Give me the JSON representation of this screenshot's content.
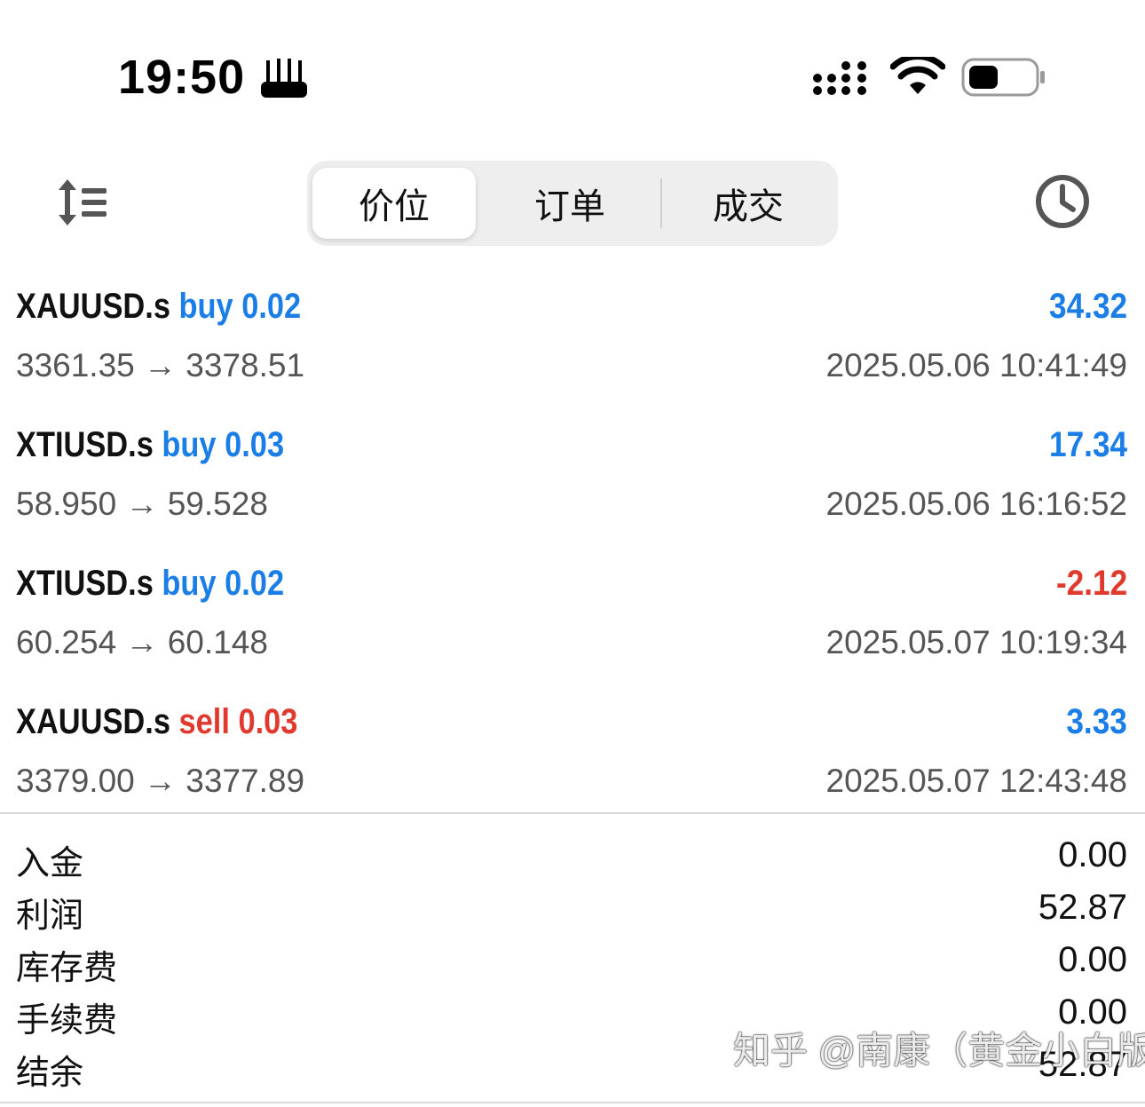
{
  "status_bar": {
    "time": "19:50"
  },
  "toolbar": {
    "tabs": [
      "价位",
      "订单",
      "成交"
    ],
    "active_tab": "价位"
  },
  "deals": [
    {
      "symbol": "XAUUSD.s",
      "side": "buy 0.02",
      "side_color": "#1a7ee6",
      "profit": "34.32",
      "profit_color": "#1a7ee6",
      "prices": "3361.35 → 3378.51",
      "time": "2025.05.06 10:41:49"
    },
    {
      "symbol": "XTIUSD.s",
      "side": "buy 0.03",
      "side_color": "#1a7ee6",
      "profit": "17.34",
      "profit_color": "#1a7ee6",
      "prices": "58.950 → 59.528",
      "time": "2025.05.06 16:16:52"
    },
    {
      "symbol": "XTIUSD.s",
      "side": "buy 0.02",
      "side_color": "#1a7ee6",
      "profit": "-2.12",
      "profit_color": "#e0392e",
      "prices": "60.254 → 60.148",
      "time": "2025.05.07 10:19:34"
    },
    {
      "symbol": "XAUUSD.s",
      "side": "sell 0.03",
      "side_color": "#e0392e",
      "profit": "3.33",
      "profit_color": "#1a7ee6",
      "prices": "3379.00 → 3377.89",
      "time": "2025.05.07 12:43:48"
    }
  ],
  "summary": [
    {
      "label": "入金",
      "value": "0.00"
    },
    {
      "label": "利润",
      "value": "52.87"
    },
    {
      "label": "库存费",
      "value": "0.00"
    },
    {
      "label": "手续费",
      "value": "0.00"
    },
    {
      "label": "结余",
      "value": "52.87"
    }
  ],
  "watermark": "知乎 @南康（黄金小白版）",
  "icons": {
    "sort": "sort-icon",
    "history": "clock-icon",
    "signal": "signal-icon",
    "wifi": "wifi-icon",
    "battery": "battery-icon"
  }
}
